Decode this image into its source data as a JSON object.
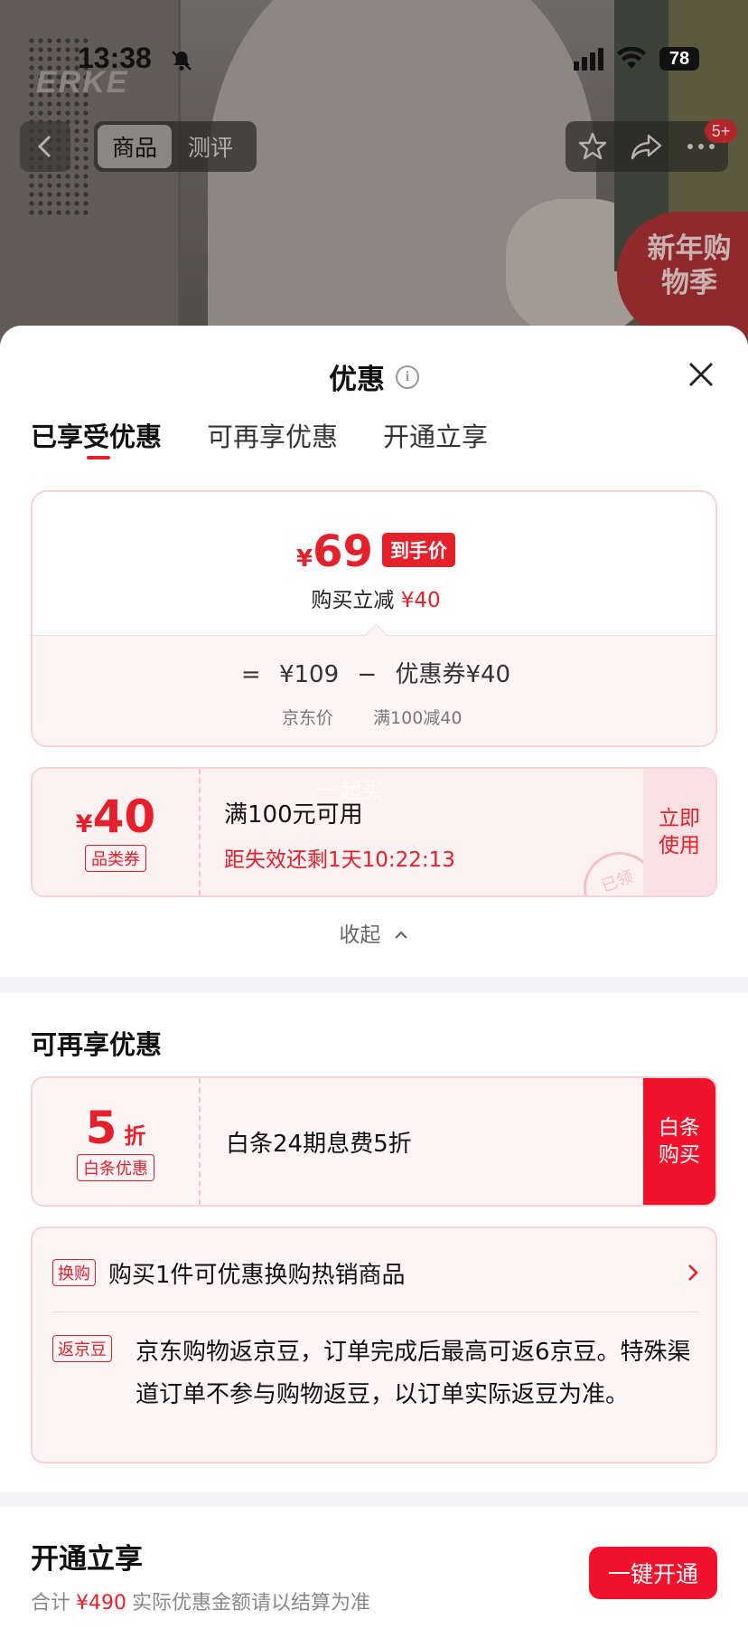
{
  "status_bar": {
    "time": "13:38",
    "battery": "78"
  },
  "background": {
    "brand": "ERKE",
    "promo": "新年购物季"
  },
  "top_nav": {
    "tabs": [
      "商品",
      "测评"
    ],
    "badge": "5+"
  },
  "sheet": {
    "title": "优惠",
    "tabs": [
      "已享受优惠",
      "可再享优惠",
      "开通立享"
    ],
    "final_price": {
      "currency": "¥",
      "value": "69",
      "tag": "到手价"
    },
    "instant_discount": {
      "label": "购买立减",
      "value": "¥40"
    },
    "formula": {
      "equals": "=",
      "base_price": "¥109",
      "minus": "−",
      "coupon": "优惠券¥40",
      "base_label": "京东价",
      "coupon_label": "满100减40"
    },
    "coupon": {
      "currency": "¥",
      "amount": "40",
      "type": "品类券",
      "condition": "满100元可用",
      "expiry": "距失效还剩1天10:22:13",
      "action": "立即使用",
      "watermark": "一起买",
      "stamp": "已领"
    },
    "collapse": "收起"
  },
  "more_offers": {
    "title": "可再享优惠",
    "baitiao": {
      "value": "5",
      "unit": "折",
      "type": "白条优惠",
      "text": "白条24期息费5折",
      "action": "白条购买"
    },
    "exchange": {
      "tag": "换购",
      "text": "购买1件可优惠换购热销商品"
    },
    "jingdou": {
      "tag": "返京豆",
      "text": "京东购物返京豆，订单完成后最高可返6京豆。特殊渠道订单不参与购物返豆，以订单实际返豆为准。"
    }
  },
  "open_section": {
    "title": "开通立享",
    "total_label": "合计",
    "total": "¥490",
    "note": "实际优惠金额请以结算为准",
    "button": "一键开通"
  },
  "colors": {
    "accent": "#e4202b",
    "button": "#f1122b"
  }
}
